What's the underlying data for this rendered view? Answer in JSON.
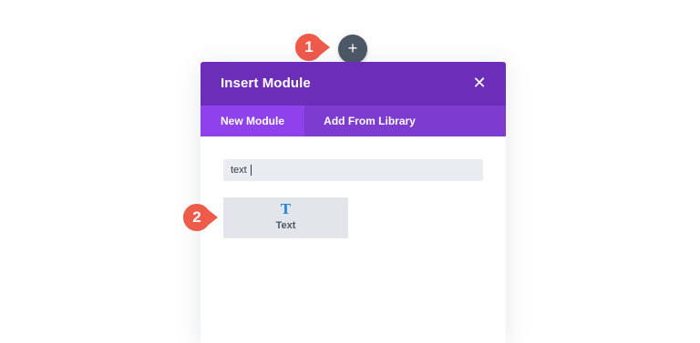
{
  "add_button": {
    "label": "+"
  },
  "markers": [
    {
      "label": "1"
    },
    {
      "label": "2"
    }
  ],
  "modal": {
    "title": "Insert Module",
    "close_label": "✕",
    "tabs": [
      {
        "label": "New Module",
        "active": true
      },
      {
        "label": "Add From Library",
        "active": false
      }
    ],
    "search": {
      "value": "text",
      "placeholder": ""
    },
    "modules": [
      {
        "icon": "text-icon",
        "icon_glyph": "T",
        "label": "Text"
      }
    ]
  },
  "colors": {
    "header": "#6c2eb9",
    "tab_bar": "#7e3bd0",
    "tab_active": "#8f42ec",
    "marker": "#ef5b4b",
    "add_button": "#4c5866",
    "module_icon": "#2b87da"
  }
}
